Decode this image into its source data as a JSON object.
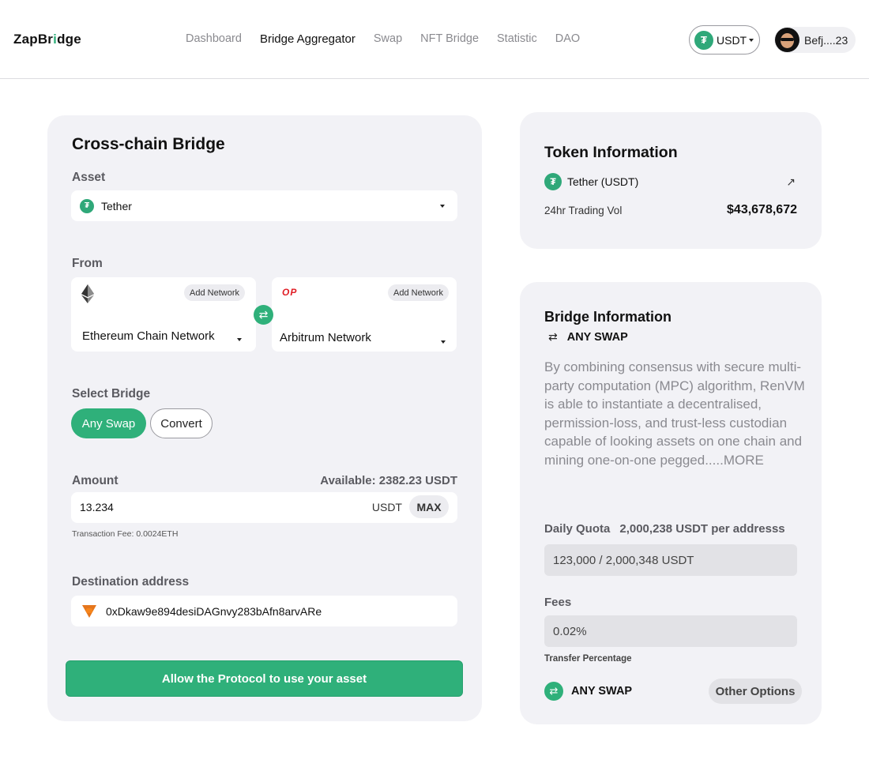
{
  "header": {
    "logo_pre": "ZapBr",
    "logo_dot": "i",
    "logo_post": "dge",
    "nav": [
      "Dashboard",
      "Bridge Aggregator",
      "Swap",
      "NFT Bridge",
      "Statistic",
      "DAO"
    ],
    "token_label": "USDT",
    "user_name": "Befj....23"
  },
  "bridge_form": {
    "title": "Cross-chain Bridge",
    "asset_label": "Asset",
    "asset_value": "Tether",
    "from_label": "From",
    "from_network": {
      "add_label": "Add Network",
      "name": "Ethereum Chain Network"
    },
    "to_network": {
      "add_label": "Add Network",
      "badge": "OP",
      "name": "Arbitrum Network"
    },
    "select_bridge_label": "Select Bridge",
    "bridge_options": [
      "Any Swap",
      "Convert"
    ],
    "amount_label": "Amount",
    "available": "Available: 2382.23 USDT",
    "amount_value": "13.234",
    "amount_unit": "USDT",
    "max_label": "MAX",
    "fee_note": "Transaction Fee: 0.0024ETH",
    "destination_label": "Destination address",
    "destination_value": "0xDkaw9e894desiDAGnvy283bAfn8arvARe",
    "cta_label": "Allow the Protocol to use your asset"
  },
  "token_info": {
    "title": "Token Information",
    "token_name": "Tether (USDT)",
    "volume_label": "24hr Trading Vol",
    "volume_value": "$43,678,672"
  },
  "bridge_info": {
    "title": "Bridge Information",
    "subtitle": "ANY SWAP",
    "description": "By combining consensus with secure multi-party computation (MPC) algorithm, RenVM is able to instantiate a decentralised, permission-loss, and trust-less custodian capable of looking assets on one chain and mining one-on-one pegged.....MORE",
    "quota_label": "Daily Quota",
    "quota_value": "2,000,238 USDT per addresss",
    "quota_bar": "123,000 / 2,000,348 USDT",
    "fees_label": "Fees",
    "fees_value": "0.02%",
    "transfer_label": "Transfer Percentage",
    "bottom_label": "ANY SWAP",
    "other_options": "Other Options"
  },
  "colors": {
    "accent": "#2fb07a",
    "card": "#f2f2f6",
    "tether": "#2fa879"
  },
  "icons": [
    "tether-icon",
    "ethereum-icon",
    "optimism-icon",
    "swap-arrows-icon",
    "metamask-fox-icon",
    "external-link-icon",
    "caret-down-icon"
  ]
}
